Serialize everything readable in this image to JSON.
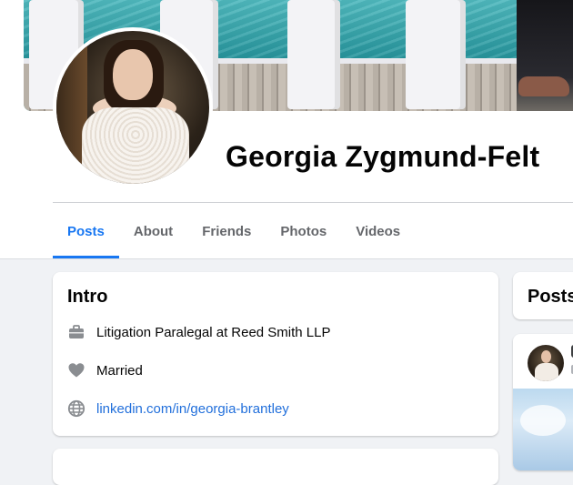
{
  "profile": {
    "name": "Georgia Zygmund-Felt"
  },
  "tabs": [
    {
      "label": "Posts",
      "active": true
    },
    {
      "label": "About",
      "active": false
    },
    {
      "label": "Friends",
      "active": false
    },
    {
      "label": "Photos",
      "active": false
    },
    {
      "label": "Videos",
      "active": false
    }
  ],
  "intro": {
    "title": "Intro",
    "work": {
      "icon": "briefcase-icon",
      "text": "Litigation Paralegal at",
      "employer": "Reed Smith LLP"
    },
    "relationship": {
      "icon": "heart-icon",
      "text": "Married"
    },
    "website": {
      "icon": "globe-icon",
      "text": "linkedin.com/in/georgia-brantley"
    }
  },
  "posts_panel": {
    "title": "Posts"
  },
  "colors": {
    "accent": "#1877f2",
    "link": "#216fdb",
    "background": "#f0f2f5",
    "icon_gray": "#8a8d91"
  }
}
